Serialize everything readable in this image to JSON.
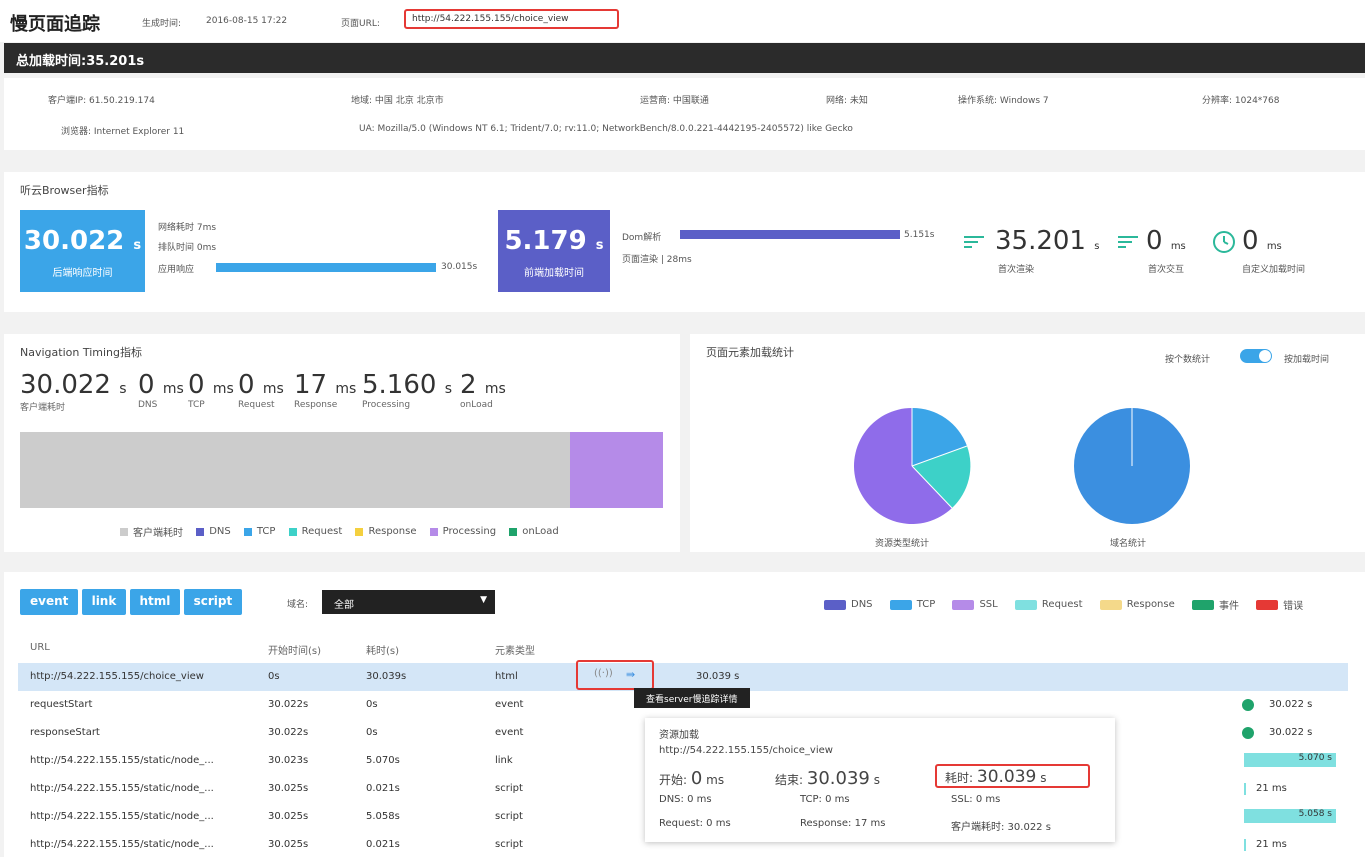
{
  "header": {
    "title": "慢页面追踪",
    "generated_label": "生成时间:",
    "generated_time": "2016-08-15 17:22",
    "url_label": "页面URL:",
    "url": "http://54.222.155.155/choice_view"
  },
  "total_load": "总加载时间:35.201s",
  "client_info": {
    "ip": "客户端IP: 61.50.219.174",
    "region": "地域: 中国 北京 北京市",
    "isp": "运营商: 中国联通",
    "network": "网络: 未知",
    "os": "操作系统: Windows 7",
    "resolution": "分辨率: 1024*768",
    "browser": "浏览器: Internet Explorer 11",
    "ua": "UA: Mozilla/5.0 (Windows NT 6.1; Trident/7.0; rv:11.0; NetworkBench/8.0.0.221-4442195-2405572) like Gecko"
  },
  "browser_metrics": {
    "title": "听云Browser指标",
    "backend_value": "30.022",
    "backend_unit": "s",
    "backend_label": "后端响应时间",
    "network_row": "网络耗时  7ms",
    "queue_row": "排队时间  0ms",
    "app_label": "应用响应",
    "app_value": "30.015s",
    "frontend_value": "5.179",
    "frontend_unit": "s",
    "frontend_label": "前端加载时间",
    "dom_label": "Dom解析",
    "dom_value": "5.151s",
    "render_row": "页面渲染 | 28ms",
    "first_render_value": "35.201",
    "first_render_unit": "s",
    "first_render_label": "首次渲染",
    "first_interact_value": "0",
    "first_interact_unit": "ms",
    "first_interact_label": "首次交互",
    "custom_value": "0",
    "custom_unit": "ms",
    "custom_label": "自定义加载时间",
    "colors": {
      "backend": "#3ba5e8",
      "frontend": "#5b5fc7",
      "green": "#2bb89a"
    }
  },
  "nav_timing": {
    "title": "Navigation Timing指标",
    "metrics": [
      {
        "value": "30.022",
        "unit": "s",
        "label": "客户端耗时"
      },
      {
        "value": "0",
        "unit": "ms",
        "label": "DNS"
      },
      {
        "value": "0",
        "unit": "ms",
        "label": "TCP"
      },
      {
        "value": "0",
        "unit": "ms",
        "label": "Request"
      },
      {
        "value": "17",
        "unit": "ms",
        "label": "Response"
      },
      {
        "value": "5.160",
        "unit": "s",
        "label": "Processing"
      },
      {
        "value": "2",
        "unit": "ms",
        "label": "onLoad"
      }
    ],
    "legend": [
      "客户端耗时",
      "DNS",
      "TCP",
      "Request",
      "Response",
      "Processing",
      "onLoad"
    ],
    "legend_colors": [
      "#cccccc",
      "#5b5fc7",
      "#3ba5e8",
      "#3dd1c8",
      "#f4d03f",
      "#b58be8",
      "#1fa36b"
    ]
  },
  "element_stats": {
    "title": "页面元素加载统计",
    "toggle_left": "按个数统计",
    "toggle_right": "按加载时间",
    "pie1_label": "资源类型统计",
    "pie2_label": "域名统计"
  },
  "filters": {
    "buttons": [
      "event",
      "link",
      "html",
      "script"
    ],
    "domain_label": "域名:",
    "domain_value": "全部"
  },
  "right_legend": {
    "items": [
      "DNS",
      "TCP",
      "SSL",
      "Request",
      "Response",
      "事件",
      "错误"
    ],
    "colors": [
      "#5b5fc7",
      "#3ba5e8",
      "#b58be8",
      "#7fe0e0",
      "#f4d98a",
      "#1fa36b",
      "#e53935"
    ]
  },
  "table": {
    "headers": [
      "URL",
      "开始时间(s)",
      "耗时(s)",
      "元素类型"
    ],
    "rows": [
      {
        "url": "http://54.222.155.155/choice_view",
        "start": "0s",
        "dur": "30.039s",
        "type": "html",
        "bar": "30.039 s"
      },
      {
        "url": "requestStart",
        "start": "30.022s",
        "dur": "0s",
        "type": "event",
        "bar": "30.022 s"
      },
      {
        "url": "responseStart",
        "start": "30.022s",
        "dur": "0s",
        "type": "event",
        "bar": "30.022 s"
      },
      {
        "url": "http://54.222.155.155/static/node_...",
        "start": "30.023s",
        "dur": "5.070s",
        "type": "link",
        "bar": "5.070 s"
      },
      {
        "url": "http://54.222.155.155/static/node_...",
        "start": "30.025s",
        "dur": "0.021s",
        "type": "script",
        "bar": "21 ms"
      },
      {
        "url": "http://54.222.155.155/static/node_...",
        "start": "30.025s",
        "dur": "5.058s",
        "type": "script",
        "bar": "5.058 s"
      },
      {
        "url": "http://54.222.155.155/static/node_...",
        "start": "30.025s",
        "dur": "0.021s",
        "type": "script",
        "bar": "21 ms"
      }
    ]
  },
  "row_action": {
    "tooltip": "查看server慢追踪详情"
  },
  "detail_popup": {
    "title": "资源加载",
    "url": "http://54.222.155.155/choice_view",
    "start_label": "开始:",
    "start_value": "0",
    "start_unit": "ms",
    "end_label": "结束:",
    "end_value": "30.039",
    "end_unit": "s",
    "dur_label": "耗时:",
    "dur_value": "30.039",
    "dur_unit": "s",
    "dns": "DNS:  0 ms",
    "tcp": "TCP:  0 ms",
    "ssl": "SSL:  0 ms",
    "request": "Request:  0 ms",
    "response": "Response:  17 ms",
    "client": "客户端耗时:  30.022 s"
  }
}
